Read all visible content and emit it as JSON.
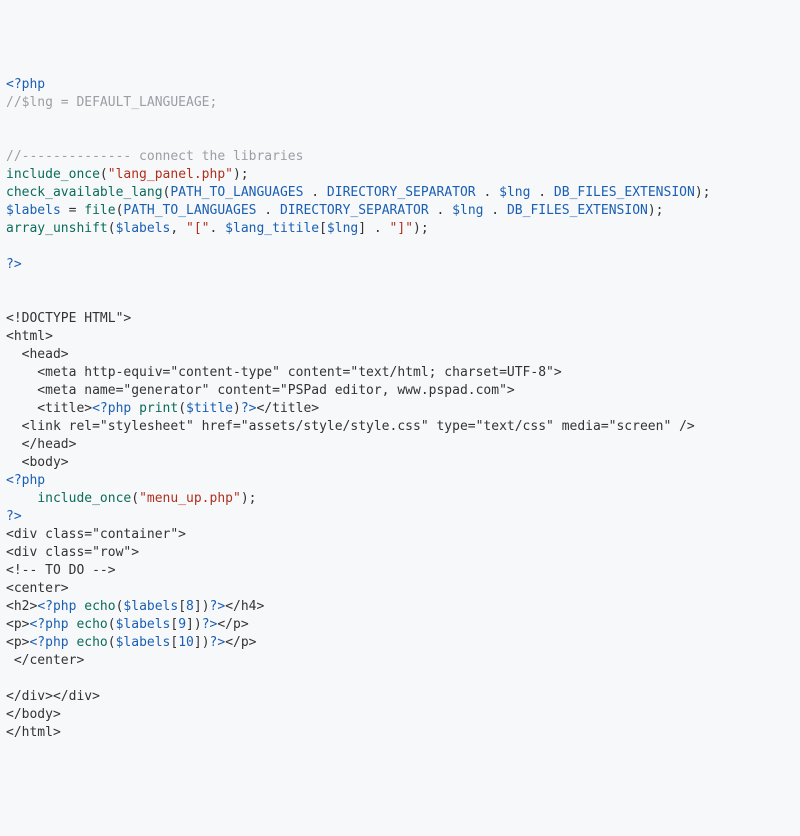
{
  "code": {
    "l01_open": "<?php",
    "l02_comment": "//$lng = DEFAULT_LANGUEAGE;",
    "l03_blank": "",
    "l04_blank": "",
    "l05_comment": "//-------------- connect the libraries",
    "l06_func": "include_once",
    "l06_paren_o": "(",
    "l06_str": "\"lang_panel.php\"",
    "l06_paren_c": ");",
    "l07_func": "check_available_lang",
    "l07_paren_o": "(",
    "l07_c1": "PATH_TO_LANGUAGES",
    "l07_dot1": " . ",
    "l07_c2": "DIRECTORY_SEPARATOR",
    "l07_dot2": " . ",
    "l07_v1": "$lng",
    "l07_dot3": " . ",
    "l07_c3": "DB_FILES_EXTENSION",
    "l07_paren_c": ");",
    "l08_var": "$labels",
    "l08_eq": " = ",
    "l08_func": "file",
    "l08_paren_o": "(",
    "l08_c1": "PATH_TO_LANGUAGES",
    "l08_dot1": " . ",
    "l08_c2": "DIRECTORY_SEPARATOR",
    "l08_dot2": " . ",
    "l08_v1": "$lng",
    "l08_dot3": " . ",
    "l08_c3": "DB_FILES_EXTENSION",
    "l08_paren_c": ");",
    "l09_func": "array_unshift",
    "l09_paren_o": "(",
    "l09_v1": "$labels",
    "l09_comma": ", ",
    "l09_str1": "\"[\"",
    "l09_dot1": ". ",
    "l09_v2": "$lang_titile",
    "l09_br_o": "[",
    "l09_v3": "$lng",
    "l09_br_c": "]",
    "l09_dot2": " . ",
    "l09_str2": "\"]\"",
    "l09_paren_c": ");",
    "l10_blank": "",
    "l11_close": "?>",
    "l12_blank": "",
    "l13_blank": "",
    "l14": "<!DOCTYPE HTML\">",
    "l15": "<html>",
    "l16": "  <head>",
    "l17": "    <meta http-equiv=\"content-type\" content=\"text/html; charset=UTF-8\">",
    "l18": "    <meta name=\"generator\" content=\"PSPad editor, www.pspad.com\">",
    "l19_pre": "    <title>",
    "l19_open": "<?php",
    "l19_sp1": " ",
    "l19_func": "print",
    "l19_paren_o": "(",
    "l19_var": "$title",
    "l19_paren_c": ")",
    "l19_close": "?>",
    "l19_post": "</title>",
    "l20": "  <link rel=\"stylesheet\" href=\"assets/style/style.css\" type=\"text/css\" media=\"screen\" />",
    "l21": "  </head>",
    "l22": "  <body>",
    "l23_open": "<?php",
    "l24_indent": "    ",
    "l24_func": "include_once",
    "l24_paren_o": "(",
    "l24_str": "\"menu_up.php\"",
    "l24_paren_c": ");",
    "l25_close": "?>",
    "l26": "<div class=\"container\">",
    "l27": "<div class=\"row\">",
    "l28": "<!-- TO DO -->",
    "l29": "<center>",
    "l30_pre": "<h2>",
    "l30_open": "<?php",
    "l30_sp1": " ",
    "l30_func": "echo",
    "l30_paren_o": "(",
    "l30_var": "$labels",
    "l30_br_o": "[",
    "l30_idx": "8",
    "l30_br_c": "]",
    "l30_paren_c": ")",
    "l30_close": "?>",
    "l30_post": "</h4>",
    "l31_pre": "<p>",
    "l31_open": "<?php",
    "l31_sp1": " ",
    "l31_func": "echo",
    "l31_paren_o": "(",
    "l31_var": "$labels",
    "l31_br_o": "[",
    "l31_idx": "9",
    "l31_br_c": "]",
    "l31_paren_c": ")",
    "l31_close": "?>",
    "l31_post": "</p>",
    "l32_pre": "<p>",
    "l32_open": "<?php",
    "l32_sp1": " ",
    "l32_func": "echo",
    "l32_paren_o": "(",
    "l32_var": "$labels",
    "l32_br_o": "[",
    "l32_idx": "10",
    "l32_br_c": "]",
    "l32_paren_c": ")",
    "l32_close": "?>",
    "l32_post": "</p>",
    "l33": " </center>",
    "l34_blank": "",
    "l35": "</div></div>",
    "l36": "</body>",
    "l37": "</html>"
  }
}
